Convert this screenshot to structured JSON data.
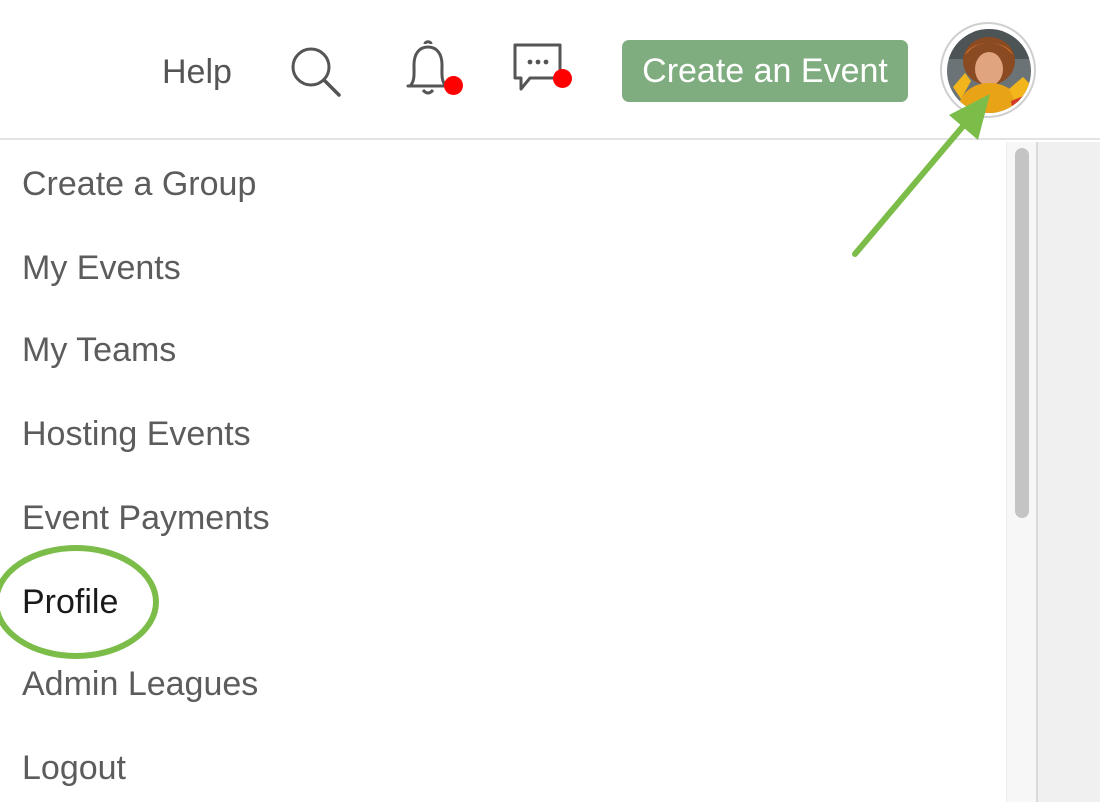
{
  "header": {
    "help_label": "Help",
    "create_event_label": "Create an Event",
    "icons": {
      "search": "search-icon",
      "notifications": "bell-icon",
      "messages": "chat-bubble-icon",
      "avatar": "user-avatar"
    },
    "notification_dot_color": "#ff0000",
    "accent_color": "#80ad80"
  },
  "menu": {
    "items": [
      {
        "label": "Create a Group"
      },
      {
        "label": "My Events"
      },
      {
        "label": "My Teams"
      },
      {
        "label": "Hosting Events"
      },
      {
        "label": "Event Payments"
      },
      {
        "label": "Profile",
        "highlighted": true
      },
      {
        "label": "Admin Leagues"
      },
      {
        "label": "Logout"
      }
    ]
  },
  "annotations": {
    "color": "#7cbd4a",
    "arrow_target": "user-avatar",
    "circled_item": "Profile"
  }
}
